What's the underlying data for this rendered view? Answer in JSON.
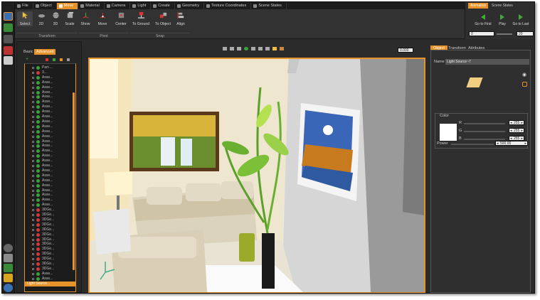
{
  "menu": {
    "tabs": [
      {
        "label": "File"
      },
      {
        "label": "Object"
      },
      {
        "label": "Move"
      },
      {
        "label": "Material"
      },
      {
        "label": "Camera"
      },
      {
        "label": "Light"
      },
      {
        "label": "Create"
      },
      {
        "label": "Geometry"
      },
      {
        "label": "Texture Coordinates"
      },
      {
        "label": "Scene States"
      }
    ],
    "active": "Move"
  },
  "ribbon": {
    "buttons": [
      {
        "label": "Select"
      },
      {
        "label": "2D"
      },
      {
        "label": "3D"
      },
      {
        "label": "Scale"
      },
      {
        "label": "Show"
      },
      {
        "label": "Move"
      },
      {
        "label": "Center"
      },
      {
        "label": "To Ground"
      },
      {
        "label": "To Object"
      },
      {
        "label": "Align"
      }
    ],
    "groups": [
      {
        "label": "Transform"
      },
      {
        "label": "Pivot"
      },
      {
        "label": "Snap"
      }
    ]
  },
  "animation": {
    "tabs": [
      {
        "label": "Animation"
      },
      {
        "label": "Scene States"
      }
    ],
    "buttons": [
      {
        "label": "Go to First"
      },
      {
        "label": "Play"
      },
      {
        "label": "Go to Last"
      }
    ],
    "start_frame": "0",
    "end_frame": "20"
  },
  "left_panel": {
    "tabs": [
      {
        "label": "Basic"
      },
      {
        "label": "Advanced"
      }
    ],
    "tree_items": [
      {
        "label": "Part-...",
        "color": "#3aa23a"
      },
      {
        "label": "3...",
        "color": "#d13a3a"
      },
      {
        "label": "Asse...",
        "color": "#3aa23a"
      },
      {
        "label": "Asse...",
        "color": "#3aa23a"
      },
      {
        "label": "Asse...",
        "color": "#3aa23a"
      },
      {
        "label": "Asse...",
        "color": "#3aa23a"
      },
      {
        "label": "Asse...",
        "color": "#3aa23a"
      },
      {
        "label": "Asse...",
        "color": "#3aa23a"
      },
      {
        "label": "Asse...",
        "color": "#3aa23a"
      },
      {
        "label": "Asse...",
        "color": "#3aa23a"
      },
      {
        "label": "Asse...",
        "color": "#3aa23a"
      },
      {
        "label": "Asse...",
        "color": "#3aa23a"
      },
      {
        "label": "Asse...",
        "color": "#3aa23a"
      },
      {
        "label": "Asse...",
        "color": "#3aa23a"
      },
      {
        "label": "Asse...",
        "color": "#3aa23a"
      },
      {
        "label": "Asse...",
        "color": "#3aa23a"
      },
      {
        "label": "Asse...",
        "color": "#3aa23a"
      },
      {
        "label": "Asse...",
        "color": "#3aa23a"
      },
      {
        "label": "Asse...",
        "color": "#3aa23a"
      },
      {
        "label": "Asse...",
        "color": "#3aa23a"
      },
      {
        "label": "Asse...",
        "color": "#3aa23a"
      },
      {
        "label": "Asse...",
        "color": "#3aa23a"
      },
      {
        "label": "Asse...",
        "color": "#3aa23a"
      },
      {
        "label": "Asse...",
        "color": "#3aa23a"
      },
      {
        "label": "Asse...",
        "color": "#3aa23a"
      },
      {
        "label": "Asse...",
        "color": "#3aa23a"
      },
      {
        "label": "Asse...",
        "color": "#3aa23a"
      },
      {
        "label": "Asse...",
        "color": "#3aa23a"
      },
      {
        "label": "Asse...",
        "color": "#3aa23a"
      },
      {
        "label": "3DGe...",
        "color": "#d13a3a"
      },
      {
        "label": "3DGe...",
        "color": "#d13a3a"
      },
      {
        "label": "3DGe...",
        "color": "#d13a3a"
      },
      {
        "label": "3DGe...",
        "color": "#d13a3a"
      },
      {
        "label": "3DGe...",
        "color": "#d13a3a"
      },
      {
        "label": "3DGe...",
        "color": "#d13a3a"
      },
      {
        "label": "3DGe...",
        "color": "#d13a3a"
      },
      {
        "label": "3DGe...",
        "color": "#d13a3a"
      },
      {
        "label": "3DGe...",
        "color": "#d13a3a"
      },
      {
        "label": "3DGe...",
        "color": "#d13a3a"
      },
      {
        "label": "3DGe...",
        "color": "#d13a3a"
      },
      {
        "label": "3DGe...",
        "color": "#d13a3a"
      },
      {
        "label": "3DGe...",
        "color": "#d13a3a"
      },
      {
        "label": "Asse...",
        "color": "#3aa23a"
      },
      {
        "label": "Asse...",
        "color": "#3aa23a"
      }
    ],
    "selected_item": "Light Source..."
  },
  "viewport": {
    "camera_value": "0.000"
  },
  "right_panel": {
    "tabs": [
      {
        "label": "Object"
      },
      {
        "label": "Transform"
      },
      {
        "label": "Attributes"
      }
    ],
    "name_label": "Name",
    "name_value": "Light Source~7",
    "color_label": "Color",
    "channels": [
      {
        "label": "R",
        "value": "255"
      },
      {
        "label": "G",
        "value": "255"
      },
      {
        "label": "B",
        "value": "255"
      }
    ],
    "power_label": "Power",
    "power_value": "500.00"
  },
  "colors": {
    "accent": "#e8922a",
    "panel_bg": "#2b2b2b"
  }
}
